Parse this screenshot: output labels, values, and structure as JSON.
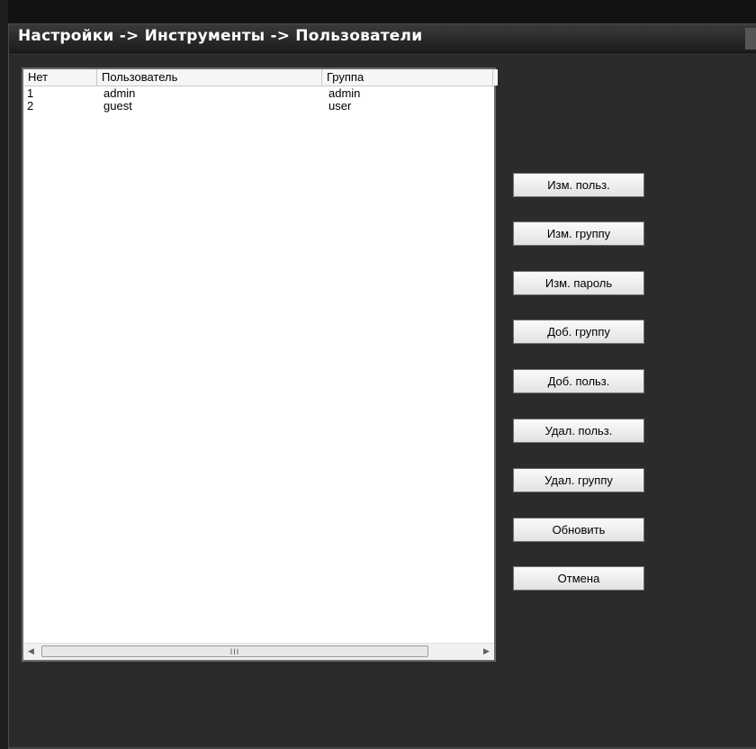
{
  "window": {
    "title": "Настройки -> Инструменты -> Пользователи"
  },
  "table": {
    "columns": [
      "Нет",
      "Пользователь",
      "Группа"
    ],
    "rows": [
      {
        "no": "1",
        "user": "admin",
        "group": "admin"
      },
      {
        "no": "2",
        "user": "guest",
        "group": "user"
      }
    ]
  },
  "scrollbar": {
    "grip_icon": "grip-lines-icon",
    "left_icon": "arrow-left-icon",
    "right_icon": "arrow-right-icon"
  },
  "buttons": {
    "edit_user": "Изм. польз.",
    "edit_group": "Изм. группу",
    "change_password": "Изм. пароль",
    "add_group": "Доб. группу",
    "add_user": "Доб. польз.",
    "delete_user": "Удал. польз.",
    "delete_group": "Удал. группу",
    "refresh": "Обновить",
    "cancel": "Отмена"
  },
  "colors": {
    "background": "#2b2b2b",
    "title_text": "#ffffff",
    "list_background": "#ffffff"
  }
}
